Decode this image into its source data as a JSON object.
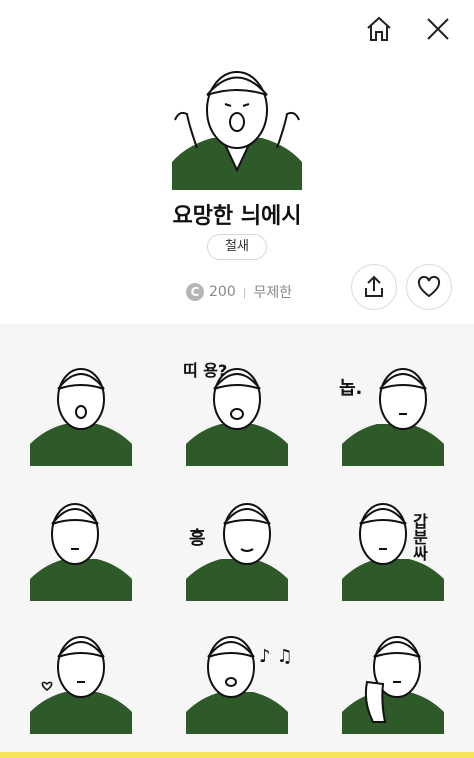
{
  "header": {
    "home_icon": "home-icon",
    "close_icon": "close-icon"
  },
  "product": {
    "title": "요망한 늬에시",
    "author": "철새",
    "coin_symbol": "C",
    "price": "200",
    "separator": "|",
    "duration": "무제한"
  },
  "actions": {
    "share_icon": "share-icon",
    "like_icon": "heart-icon"
  },
  "stickers": [
    {
      "caption": ""
    },
    {
      "caption": "띠 용?"
    },
    {
      "caption": "놉."
    },
    {
      "caption": ""
    },
    {
      "caption": "흥"
    },
    {
      "caption": "갑분싸"
    },
    {
      "caption": ""
    },
    {
      "caption": "♪ ♫"
    },
    {
      "caption": ""
    }
  ],
  "colors": {
    "shirt": "#2e5a2a",
    "accent_bar": "#f7e25a",
    "grid_bg": "#f6f6f6"
  }
}
